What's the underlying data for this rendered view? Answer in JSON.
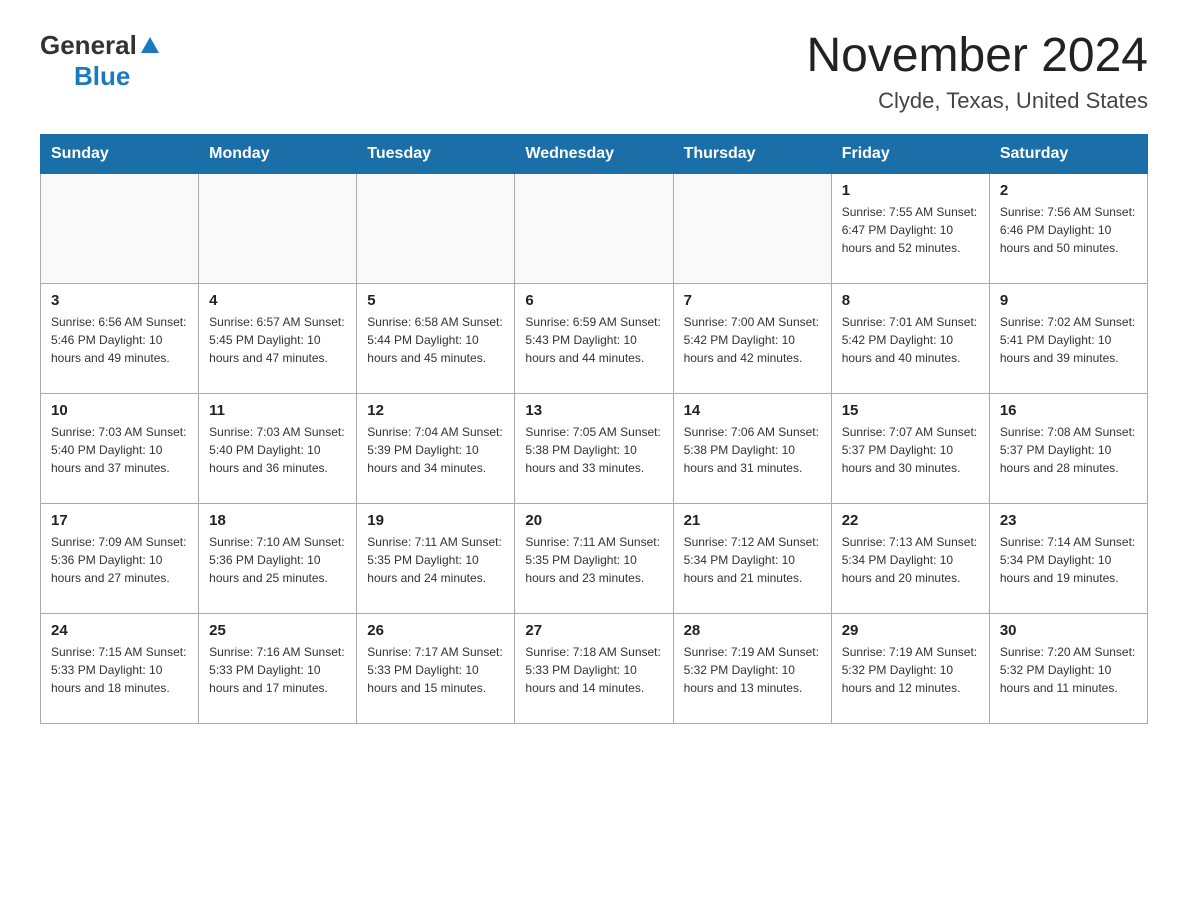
{
  "header": {
    "logo": {
      "general": "General",
      "blue": "Blue",
      "arrow_symbol": "▲"
    },
    "title": "November 2024",
    "subtitle": "Clyde, Texas, United States"
  },
  "calendar": {
    "days_of_week": [
      "Sunday",
      "Monday",
      "Tuesday",
      "Wednesday",
      "Thursday",
      "Friday",
      "Saturday"
    ],
    "weeks": [
      [
        {
          "day": "",
          "info": ""
        },
        {
          "day": "",
          "info": ""
        },
        {
          "day": "",
          "info": ""
        },
        {
          "day": "",
          "info": ""
        },
        {
          "day": "",
          "info": ""
        },
        {
          "day": "1",
          "info": "Sunrise: 7:55 AM\nSunset: 6:47 PM\nDaylight: 10 hours\nand 52 minutes."
        },
        {
          "day": "2",
          "info": "Sunrise: 7:56 AM\nSunset: 6:46 PM\nDaylight: 10 hours\nand 50 minutes."
        }
      ],
      [
        {
          "day": "3",
          "info": "Sunrise: 6:56 AM\nSunset: 5:46 PM\nDaylight: 10 hours\nand 49 minutes."
        },
        {
          "day": "4",
          "info": "Sunrise: 6:57 AM\nSunset: 5:45 PM\nDaylight: 10 hours\nand 47 minutes."
        },
        {
          "day": "5",
          "info": "Sunrise: 6:58 AM\nSunset: 5:44 PM\nDaylight: 10 hours\nand 45 minutes."
        },
        {
          "day": "6",
          "info": "Sunrise: 6:59 AM\nSunset: 5:43 PM\nDaylight: 10 hours\nand 44 minutes."
        },
        {
          "day": "7",
          "info": "Sunrise: 7:00 AM\nSunset: 5:42 PM\nDaylight: 10 hours\nand 42 minutes."
        },
        {
          "day": "8",
          "info": "Sunrise: 7:01 AM\nSunset: 5:42 PM\nDaylight: 10 hours\nand 40 minutes."
        },
        {
          "day": "9",
          "info": "Sunrise: 7:02 AM\nSunset: 5:41 PM\nDaylight: 10 hours\nand 39 minutes."
        }
      ],
      [
        {
          "day": "10",
          "info": "Sunrise: 7:03 AM\nSunset: 5:40 PM\nDaylight: 10 hours\nand 37 minutes."
        },
        {
          "day": "11",
          "info": "Sunrise: 7:03 AM\nSunset: 5:40 PM\nDaylight: 10 hours\nand 36 minutes."
        },
        {
          "day": "12",
          "info": "Sunrise: 7:04 AM\nSunset: 5:39 PM\nDaylight: 10 hours\nand 34 minutes."
        },
        {
          "day": "13",
          "info": "Sunrise: 7:05 AM\nSunset: 5:38 PM\nDaylight: 10 hours\nand 33 minutes."
        },
        {
          "day": "14",
          "info": "Sunrise: 7:06 AM\nSunset: 5:38 PM\nDaylight: 10 hours\nand 31 minutes."
        },
        {
          "day": "15",
          "info": "Sunrise: 7:07 AM\nSunset: 5:37 PM\nDaylight: 10 hours\nand 30 minutes."
        },
        {
          "day": "16",
          "info": "Sunrise: 7:08 AM\nSunset: 5:37 PM\nDaylight: 10 hours\nand 28 minutes."
        }
      ],
      [
        {
          "day": "17",
          "info": "Sunrise: 7:09 AM\nSunset: 5:36 PM\nDaylight: 10 hours\nand 27 minutes."
        },
        {
          "day": "18",
          "info": "Sunrise: 7:10 AM\nSunset: 5:36 PM\nDaylight: 10 hours\nand 25 minutes."
        },
        {
          "day": "19",
          "info": "Sunrise: 7:11 AM\nSunset: 5:35 PM\nDaylight: 10 hours\nand 24 minutes."
        },
        {
          "day": "20",
          "info": "Sunrise: 7:11 AM\nSunset: 5:35 PM\nDaylight: 10 hours\nand 23 minutes."
        },
        {
          "day": "21",
          "info": "Sunrise: 7:12 AM\nSunset: 5:34 PM\nDaylight: 10 hours\nand 21 minutes."
        },
        {
          "day": "22",
          "info": "Sunrise: 7:13 AM\nSunset: 5:34 PM\nDaylight: 10 hours\nand 20 minutes."
        },
        {
          "day": "23",
          "info": "Sunrise: 7:14 AM\nSunset: 5:34 PM\nDaylight: 10 hours\nand 19 minutes."
        }
      ],
      [
        {
          "day": "24",
          "info": "Sunrise: 7:15 AM\nSunset: 5:33 PM\nDaylight: 10 hours\nand 18 minutes."
        },
        {
          "day": "25",
          "info": "Sunrise: 7:16 AM\nSunset: 5:33 PM\nDaylight: 10 hours\nand 17 minutes."
        },
        {
          "day": "26",
          "info": "Sunrise: 7:17 AM\nSunset: 5:33 PM\nDaylight: 10 hours\nand 15 minutes."
        },
        {
          "day": "27",
          "info": "Sunrise: 7:18 AM\nSunset: 5:33 PM\nDaylight: 10 hours\nand 14 minutes."
        },
        {
          "day": "28",
          "info": "Sunrise: 7:19 AM\nSunset: 5:32 PM\nDaylight: 10 hours\nand 13 minutes."
        },
        {
          "day": "29",
          "info": "Sunrise: 7:19 AM\nSunset: 5:32 PM\nDaylight: 10 hours\nand 12 minutes."
        },
        {
          "day": "30",
          "info": "Sunrise: 7:20 AM\nSunset: 5:32 PM\nDaylight: 10 hours\nand 11 minutes."
        }
      ]
    ]
  },
  "colors": {
    "header_bg": "#1a6fa8",
    "header_text": "#ffffff",
    "border": "#aaaaaa"
  }
}
